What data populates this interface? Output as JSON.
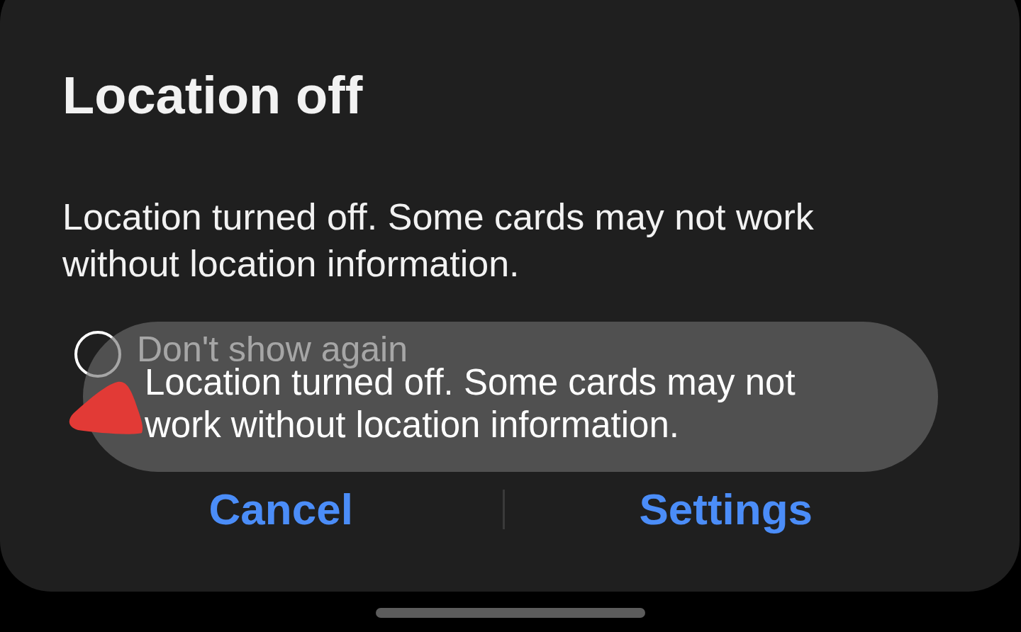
{
  "dialog": {
    "title": "Location off",
    "message": "Location turned off. Some cards may not work without location information.",
    "checkbox": {
      "label": "Don't show again",
      "checked": false
    },
    "buttons": [
      {
        "label": "Cancel"
      },
      {
        "label": "Settings"
      }
    ]
  },
  "toast": {
    "text": "Location turned off. Some cards may not work without location information."
  }
}
